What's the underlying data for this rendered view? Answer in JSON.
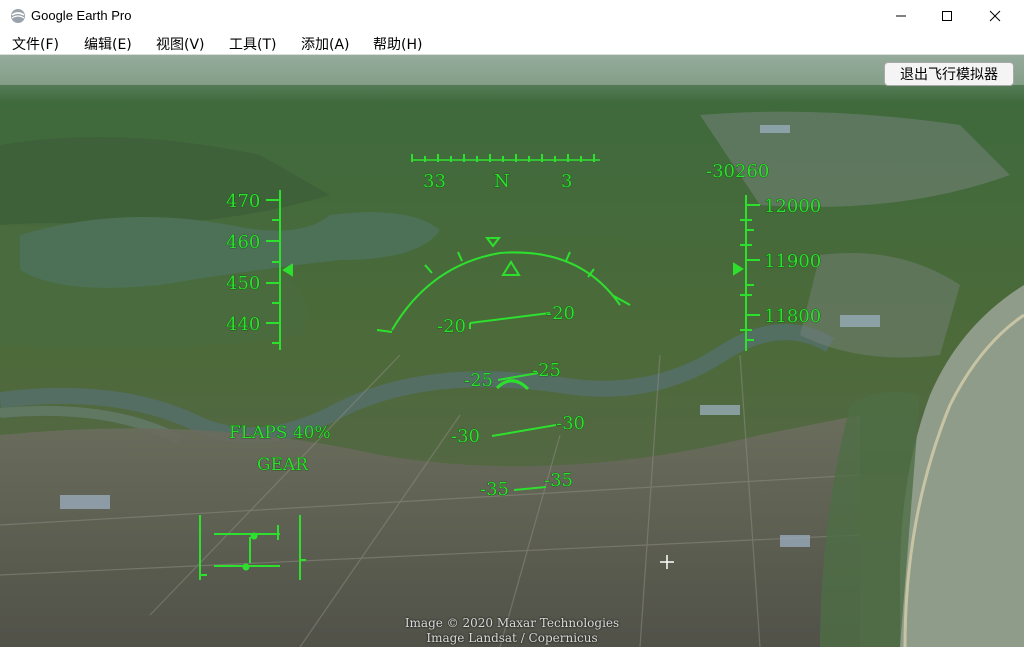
{
  "window": {
    "title": "Google Earth Pro",
    "controls": {
      "minimize": "minimize-icon",
      "maximize": "maximize-icon",
      "close": "close-icon"
    }
  },
  "menu": [
    {
      "label": "文件(F)"
    },
    {
      "label": "编辑(E)"
    },
    {
      "label": "视图(V)"
    },
    {
      "label": "工具(T)"
    },
    {
      "label": "添加(A)"
    },
    {
      "label": "帮助(H)"
    }
  ],
  "flight_sim": {
    "exit_button": "退出飞行模拟器",
    "heading": {
      "left": "33",
      "center": "N",
      "right": "3"
    },
    "vertical_speed": "-30260",
    "speed": {
      "ticks": [
        "470",
        "460",
        "450",
        "440"
      ]
    },
    "altitude": {
      "ticks": [
        "12000",
        "11900",
        "11800"
      ]
    },
    "pitch_ladder": [
      {
        "left": "-20",
        "right": "-20"
      },
      {
        "left": "-25",
        "right": "-25"
      },
      {
        "left": "-30",
        "right": "-30"
      },
      {
        "left": "-35",
        "right": "-35"
      }
    ],
    "flaps": "FLAPS 40%",
    "gear": "GEAR"
  },
  "credits": {
    "line1": "Image © 2020 Maxar Technologies",
    "line2": "Image Landsat / Copernicus"
  },
  "colors": {
    "hud": "#2ee02e",
    "titlebar": "#ffffff"
  }
}
